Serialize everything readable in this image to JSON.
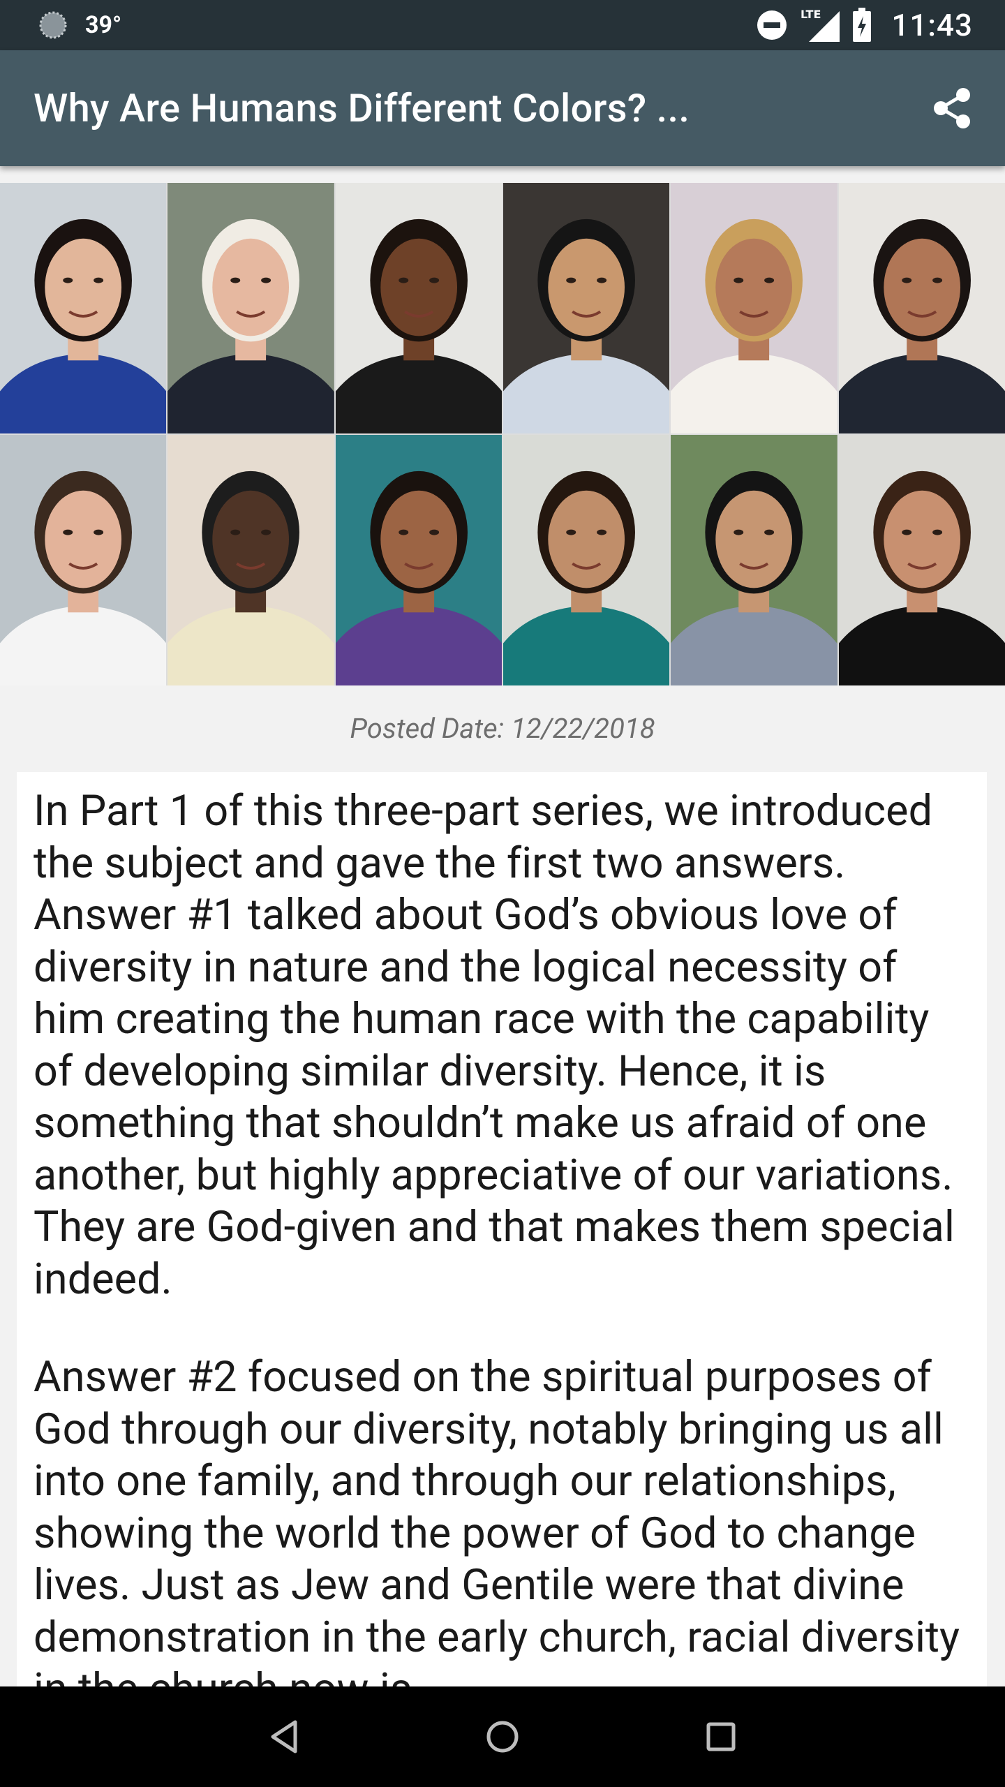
{
  "status_bar": {
    "temperature": "39°",
    "time": "11:43",
    "network_label": "LTE",
    "icons": [
      "weather-icon",
      "do-not-disturb-icon",
      "signal-icon",
      "battery-charging-icon"
    ]
  },
  "app_bar": {
    "title": "Why Are Humans Different Colors? ...",
    "share_icon": "share-icon"
  },
  "hero": {
    "description": "Collage of twelve portraits of people of different ethnicities",
    "tiles": [
      {
        "skin": "#e2b69a",
        "hair": "#1a1210",
        "bg": "#cdd3d8",
        "shirt": "#23409a"
      },
      {
        "skin": "#e6b8a0",
        "hair": "#f0ece4",
        "bg": "#7f8a7a",
        "shirt": "#1f2430"
      },
      {
        "skin": "#6e4128",
        "hair": "#1c130e",
        "bg": "#e6e6e3",
        "shirt": "#1a1a1a"
      },
      {
        "skin": "#c9986e",
        "hair": "#151515",
        "bg": "#3a3633",
        "shirt": "#cfd8e4"
      },
      {
        "skin": "#b57a5a",
        "hair": "#c99f5c",
        "bg": "#d8cfd6",
        "shirt": "#f4f1ec"
      },
      {
        "skin": "#b07656",
        "hair": "#1a1412",
        "bg": "#e8e6e2",
        "shirt": "#202632"
      },
      {
        "skin": "#e3b39a",
        "hair": "#3b2a1f",
        "bg": "#bcc4c9",
        "shirt": "#f4f4f4"
      },
      {
        "skin": "#4f3426",
        "hair": "#1d1d1d",
        "bg": "#e6dcd0",
        "shirt": "#ede6c8"
      },
      {
        "skin": "#9c6444",
        "hair": "#1a120e",
        "bg": "#2c7f86",
        "shirt": "#5c3f8f"
      },
      {
        "skin": "#c08e6a",
        "hair": "#24170f",
        "bg": "#d9dbd6",
        "shirt": "#177a7a"
      },
      {
        "skin": "#c69672",
        "hair": "#141414",
        "bg": "#6f8a5e",
        "shirt": "#8893a6"
      },
      {
        "skin": "#c89070",
        "hair": "#3a2316",
        "bg": "#dcdcd8",
        "shirt": "#111111"
      }
    ]
  },
  "article": {
    "posted_date": "Posted Date: 12/22/2018",
    "paragraphs": [
      "In Part 1 of this three-part series, we introduced the subject and gave the first two answers. Answer #1 talked about God’s obvious love of diversity in nature and the logical necessity of him creating the human race with the capability of developing similar diversity. Hence, it is something that shouldn’t make us afraid of one another, but highly appreciative of our variations. They are God-given and that makes them special indeed.",
      "Answer #2 focused on the spiritual purposes of God through our diversity, notably bringing us all into one family, and through our relationships, showing the world the power of God to change lives. Just as Jew and Gentile were that divine demonstration in the early church, racial diversity in the church now is"
    ]
  },
  "nav_bar": {
    "back": "back-triangle-icon",
    "home": "home-circle-icon",
    "recents": "recents-square-icon"
  }
}
